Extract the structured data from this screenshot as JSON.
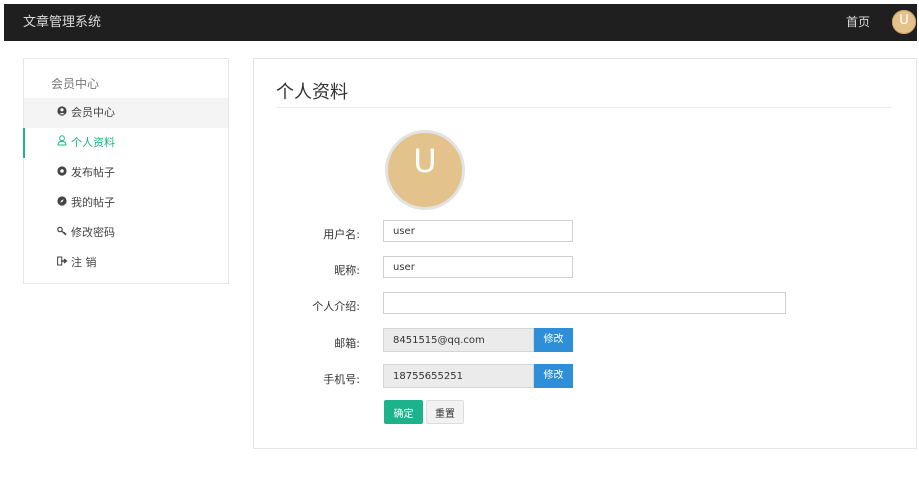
{
  "header": {
    "brand": "文章管理系统",
    "home_link": "首页",
    "avatar_letter": "U"
  },
  "sidebar": {
    "title": "会员中心",
    "items": [
      {
        "label": "会员中心",
        "icon": "user-circle-icon"
      },
      {
        "label": "个人资料",
        "icon": "user-icon"
      },
      {
        "label": "发布帖子",
        "icon": "chrome-icon"
      },
      {
        "label": "我的帖子",
        "icon": "compass-icon"
      },
      {
        "label": "修改密码",
        "icon": "key-icon"
      },
      {
        "label": "注 销",
        "icon": "sign-out-icon"
      }
    ]
  },
  "profile": {
    "title": "个人资料",
    "avatar_letter": "U",
    "fields": {
      "username": {
        "label": "用户名:",
        "value": "user"
      },
      "nickname": {
        "label": "昵称:",
        "value": "user"
      },
      "intro": {
        "label": "个人介绍:",
        "value": ""
      },
      "email": {
        "label": "邮箱:",
        "value": "8451515@qq.com",
        "button": "修改"
      },
      "phone": {
        "label": "手机号:",
        "value": "18755655251",
        "button": "修改"
      }
    },
    "confirm_label": "确定",
    "reset_label": "重置"
  },
  "colors": {
    "accent": "#21b384",
    "primary_button": "#2e8fd8",
    "confirm_button": "#1bb28c",
    "avatar": "#e4c28b",
    "topbar": "#1f1f1f"
  }
}
